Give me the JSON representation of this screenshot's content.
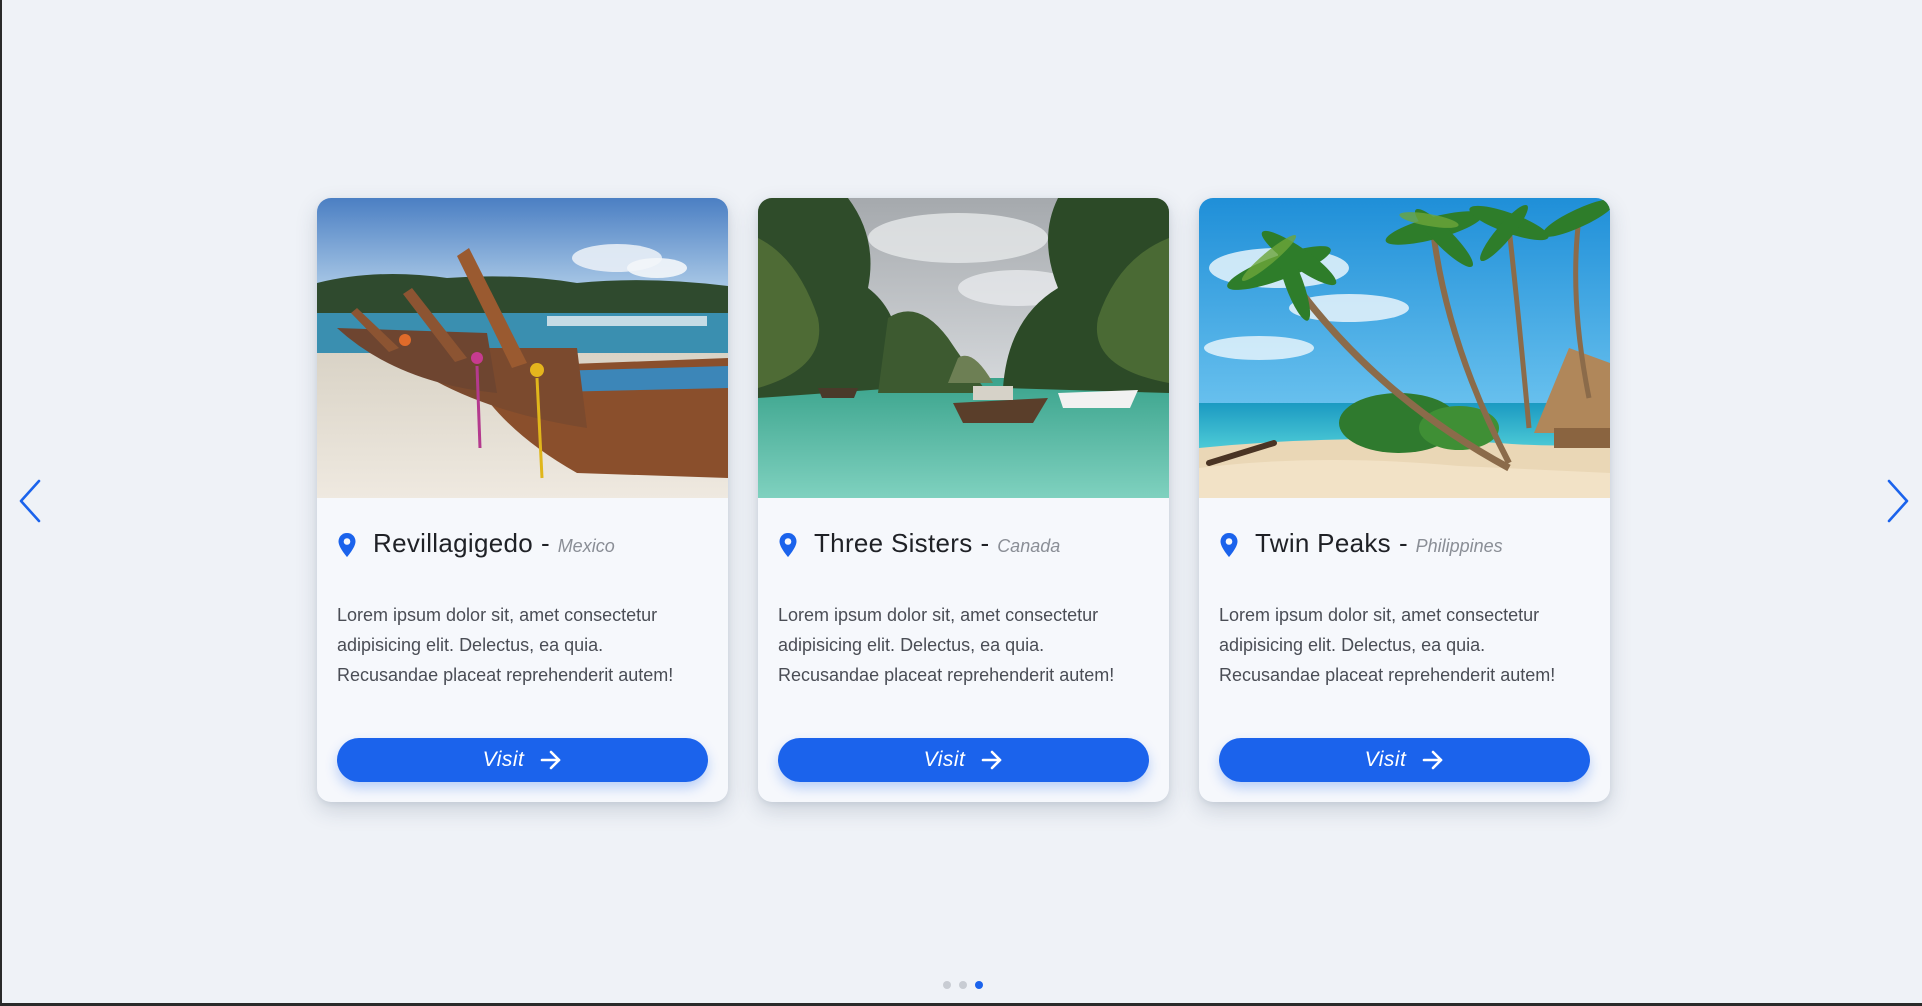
{
  "carousel": {
    "prev_icon": "chevron-left-icon",
    "next_icon": "chevron-right-icon",
    "accent_color": "#1b63ec",
    "background_color": "#eff2f7",
    "cards": [
      {
        "title": "Revillagigedo",
        "separator": "-",
        "country": "Mexico",
        "text": "Lorem ipsum dolor sit, amet consectetur adipisicing elit. Delectus, ea quia. Recusandae placeat reprehenderit autem!",
        "button_label": "Visit",
        "image": "beach-longtail-boats-photo",
        "icon": "map-pin-icon",
        "button_icon": "arrow-right-icon"
      },
      {
        "title": "Three Sisters",
        "separator": "-",
        "country": "Canada",
        "text": "Lorem ipsum dolor sit, amet consectetur adipisicing elit. Delectus, ea quia. Recusandae placeat reprehenderit autem!",
        "button_label": "Visit",
        "image": "lagoon-cliffs-photo",
        "icon": "map-pin-icon",
        "button_icon": "arrow-right-icon"
      },
      {
        "title": "Twin Peaks",
        "separator": "-",
        "country": "Philippines",
        "text": "Lorem ipsum dolor sit, amet consectetur adipisicing elit. Delectus, ea quia. Recusandae placeat reprehenderit autem!",
        "button_label": "Visit",
        "image": "tropical-palm-beach-photo",
        "icon": "map-pin-icon",
        "button_icon": "arrow-right-icon"
      }
    ],
    "pagination": {
      "total": 3,
      "active_index": 2
    }
  }
}
